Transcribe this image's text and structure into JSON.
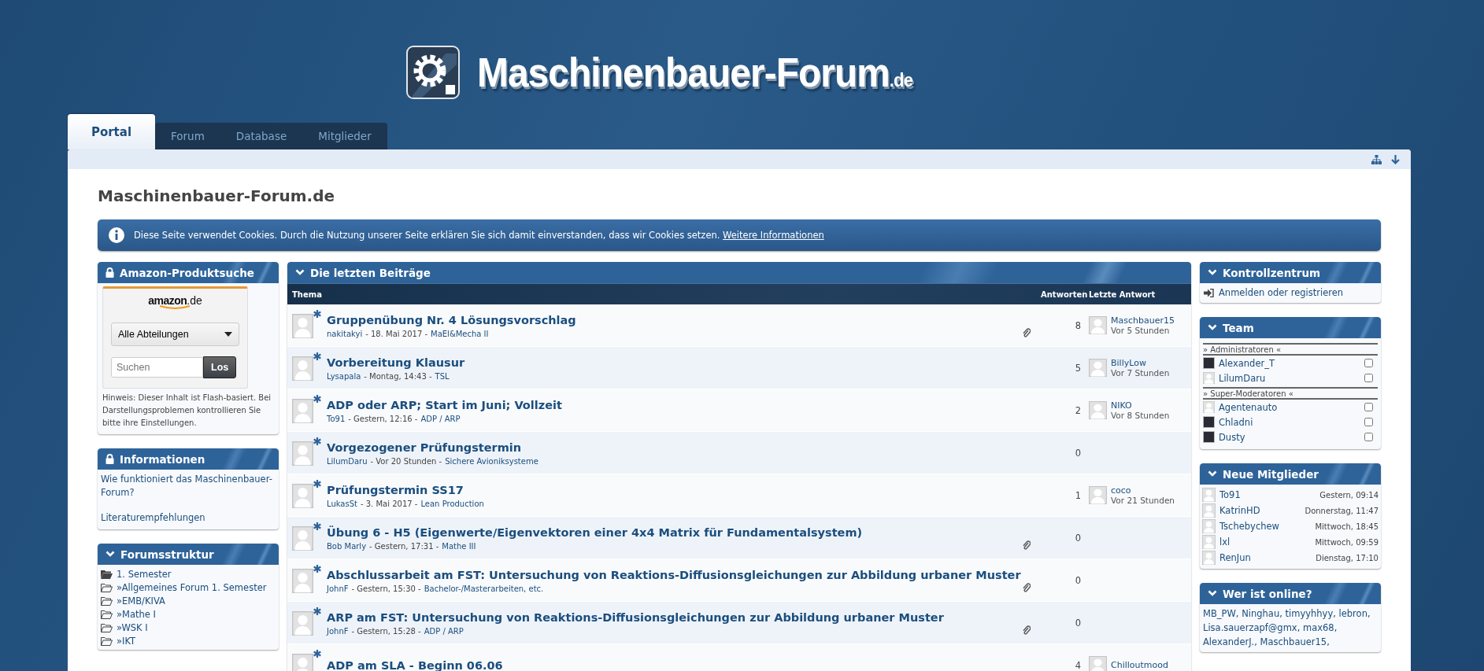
{
  "header": {
    "logo_text": "Maschinenbauer-Forum",
    "logo_suffix": ".de"
  },
  "tabs": [
    {
      "label": "Portal",
      "selected": true
    },
    {
      "label": "Forum",
      "selected": false
    },
    {
      "label": "Database",
      "selected": false
    },
    {
      "label": "Mitglieder",
      "selected": false
    }
  ],
  "page_title": "Maschinenbauer-Forum.de",
  "cookie_notice": {
    "text": "Diese Seite verwendet Cookies. Durch die Nutzung unserer Seite erklären Sie sich damit einverstanden, dass wir Cookies setzen.",
    "link": "Weitere Informationen"
  },
  "left_sidebar": {
    "amazon": {
      "title": "Amazon-Produktsuche",
      "kind": "locked",
      "logo": "amazon",
      "logo_suffix": ".de",
      "dropdown": "Alle Abteilungen",
      "search_placeholder": "Suchen",
      "button": "Los",
      "note": "Hinweis: Dieser Inhalt ist Flash-basiert. Bei Darstellungsproblemen kontrollieren Sie bitte ihre Einstellungen."
    },
    "info": {
      "title": "Informationen",
      "kind": "locked",
      "links": [
        "Wie funktioniert das Maschinenbauer-Forum?",
        "Literaturempfehlungen"
      ]
    },
    "structure": {
      "title": "Forumsstruktur",
      "kind": "collapsible",
      "items": [
        {
          "label": "1. Semester",
          "expanded": true,
          "children": [
            {
              "label": "»Allgemeines Forum 1. Semester",
              "expanded": false
            },
            {
              "label": "»EMB/KIVA",
              "expanded": false
            },
            {
              "label": "»Mathe I",
              "expanded": false
            },
            {
              "label": "»WSK I",
              "expanded": false
            },
            {
              "label": "»IKT",
              "expanded": false
            }
          ]
        }
      ]
    }
  },
  "latest_posts": {
    "title": "Die letzten Beiträge",
    "kind": "collapsible",
    "columns": [
      "Thema",
      "Antworten",
      "Letzte Antwort"
    ],
    "rows": [
      {
        "title": "Gruppenübung Nr. 4 Lösungsvorschlag",
        "author": "nakitakyi",
        "date": "- 18. Mai 2017 -",
        "forum": "MaEl&Mecha II",
        "attachment": true,
        "replies": "8",
        "last_user": "Maschbauer15",
        "last_time": "Vor 5 Stunden"
      },
      {
        "title": "Vorbereitung Klausur",
        "author": "Lysapala",
        "date": "- Montag, 14:43 -",
        "forum": "TSL",
        "attachment": false,
        "replies": "5",
        "last_user": "BillyLow",
        "last_time": "Vor 7 Stunden"
      },
      {
        "title": "ADP oder ARP; Start im Juni; Vollzeit",
        "author": "To91",
        "date": "- Gestern, 12:16 -",
        "forum": "ADP / ARP",
        "attachment": false,
        "replies": "2",
        "last_user": "NIKO",
        "last_time": "Vor 8 Stunden"
      },
      {
        "title": "Vorgezogener Prüfungstermin",
        "author": "LilumDaru",
        "date": "- Vor 20 Stunden -",
        "forum": "Sichere Avioniksysteme",
        "attachment": false,
        "replies": "0"
      },
      {
        "title": "Prüfungstermin SS17",
        "author": "LukasSt",
        "date": "- 3. Mai 2017 -",
        "forum": "Lean Production",
        "attachment": false,
        "replies": "1",
        "last_user": "coco",
        "last_time": "Vor 21 Stunden"
      },
      {
        "title": "Übung 6 - H5 (Eigenwerte/Eigenvektoren einer 4x4 Matrix für Fundamentalsystem)",
        "author": "Bob Marly",
        "date": "- Gestern, 17:31 -",
        "forum": "Mathe III",
        "attachment": true,
        "replies": "0"
      },
      {
        "title": "Abschlussarbeit am FST: Untersuchung von Reaktions-Diffusionsgleichungen zur Abbildung urbaner Muster",
        "author": "JohnF",
        "date": "- Gestern, 15:30 -",
        "forum": "Bachelor-/Masterarbeiten, etc.",
        "attachment": true,
        "replies": "0"
      },
      {
        "title": "ARP am FST: Untersuchung von Reaktions-Diffusionsgleichungen zur Abbildung urbaner Muster",
        "author": "JohnF",
        "date": "- Gestern, 15:28 -",
        "forum": "ADP / ARP",
        "attachment": true,
        "replies": "0"
      },
      {
        "title": "ADP am SLA - Beginn 06.06",
        "attachment": false,
        "replies": "4",
        "last_user": "Chilloutmood"
      }
    ]
  },
  "right_sidebar": {
    "control": {
      "title": "Kontrollzentrum",
      "kind": "collapsible",
      "link": "Anmelden oder registrieren"
    },
    "team": {
      "title": "Team",
      "kind": "collapsible",
      "groups": [
        {
          "label": "» Administratoren «",
          "members": [
            {
              "name": "Alexander_T",
              "kind": "photo",
              "checked": false
            },
            {
              "name": "LilumDaru",
              "kind": "default",
              "checked": false
            }
          ]
        },
        {
          "label": "» Super-Moderatoren «",
          "members": [
            {
              "name": "Agentenauto",
              "kind": "default",
              "checked": false
            },
            {
              "name": "Chladni",
              "kind": "photo",
              "checked": false
            },
            {
              "name": "Dusty",
              "kind": "photo",
              "checked": false
            }
          ]
        }
      ]
    },
    "new_members": {
      "title": "Neue Mitglieder",
      "kind": "collapsible",
      "members": [
        {
          "name": "To91",
          "time": "Gestern, 09:14"
        },
        {
          "name": "KatrinHD",
          "time": "Donnerstag, 11:47"
        },
        {
          "name": "Tschebychew",
          "time": "Mittwoch, 18:45"
        },
        {
          "name": "lxl",
          "time": "Mittwoch, 09:59"
        },
        {
          "name": "RenJun",
          "time": "Dienstag, 17:10"
        }
      ]
    },
    "online": {
      "title": "Wer ist online?",
      "kind": "collapsible",
      "users": [
        "MB_PW,",
        "Ninghau,",
        "timyyhhyy,",
        "lebron,",
        "Lisa.sauerzapf@gmx,",
        "max68,",
        "AlexanderJ.,",
        "Maschbauer15,"
      ]
    }
  }
}
